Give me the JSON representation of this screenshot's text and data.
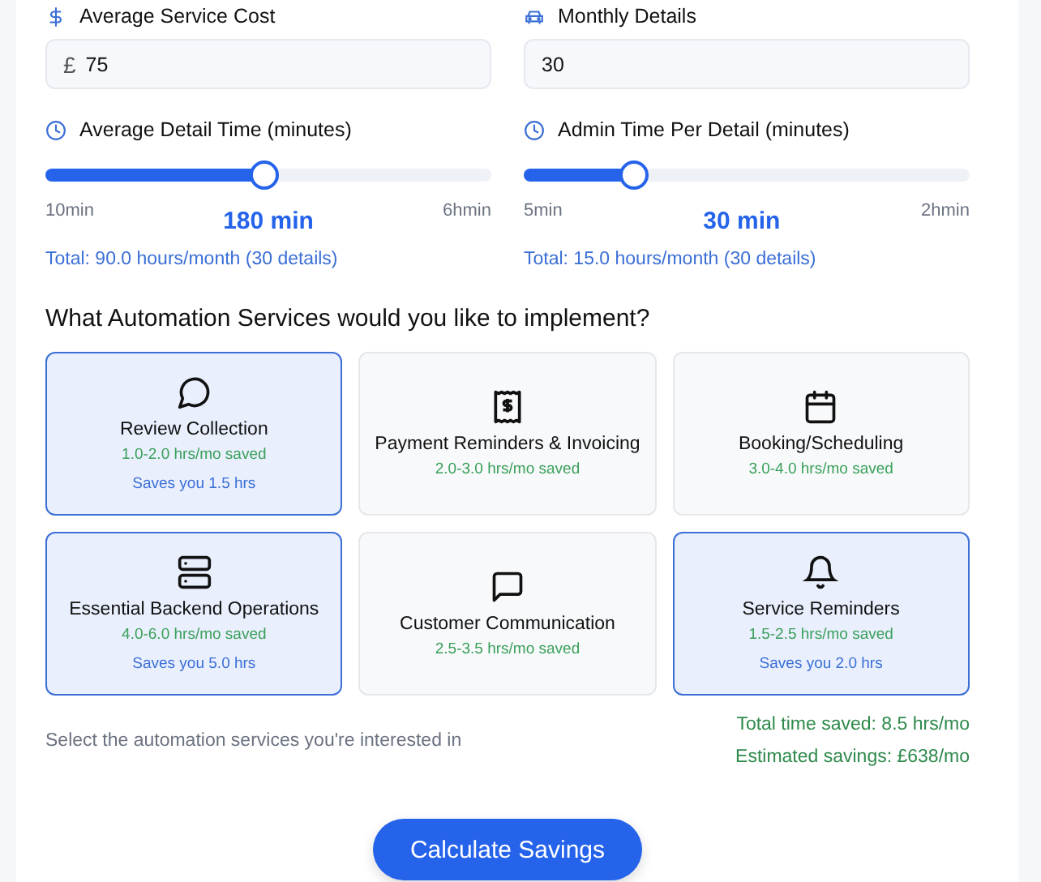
{
  "fields": [
    {
      "label": "Average Service Cost",
      "kind": "dollar",
      "prefix": "£",
      "value": "75"
    },
    {
      "label": "Monthly Details",
      "kind": "car",
      "value": "30"
    }
  ],
  "sliders": [
    {
      "label": "Average Detail Time (minutes)",
      "level": 0.49,
      "min": "10min",
      "value": "180 min",
      "max": "6hmin",
      "total": "Total: 90.0 hours/month (30 details)"
    },
    {
      "label": "Admin Time Per Detail (minutes)",
      "level": 0.23,
      "min": "5min",
      "value": "30 min",
      "max": "2hmin",
      "total": "Total: 15.0 hours/month (30 details)"
    }
  ],
  "services": {
    "heading": "What Automation Services would you like to implement?",
    "items": [
      {
        "kind": "chat",
        "title": "Review Collection",
        "range": "1.0-2.0 hrs/mo saved",
        "selected": true,
        "saves": "Saves you 1.5 hrs"
      },
      {
        "kind": "receipt",
        "title": "Payment Reminders & Invoicing",
        "range": "2.0-3.0 hrs/mo saved",
        "selected": false
      },
      {
        "kind": "calendar",
        "title": "Booking/Scheduling",
        "range": "3.0-4.0 hrs/mo saved",
        "selected": false
      },
      {
        "kind": "server",
        "title": "Essential Backend Operations",
        "range": "4.0-6.0 hrs/mo saved",
        "selected": true,
        "saves": "Saves you 5.0 hrs"
      },
      {
        "kind": "message",
        "title": "Customer Communication",
        "range": "2.5-3.5 hrs/mo saved",
        "selected": false
      },
      {
        "kind": "bell",
        "title": "Service Reminders",
        "range": "1.5-2.5 hrs/mo saved",
        "selected": true,
        "saves": "Saves you 2.0 hrs"
      }
    ]
  },
  "footer": {
    "hint": "Select the automation services you're interested in",
    "totals": [
      "Total time saved: 8.5 hrs/mo",
      "Estimated savings: £638/mo"
    ]
  },
  "button": "Calculate Savings"
}
